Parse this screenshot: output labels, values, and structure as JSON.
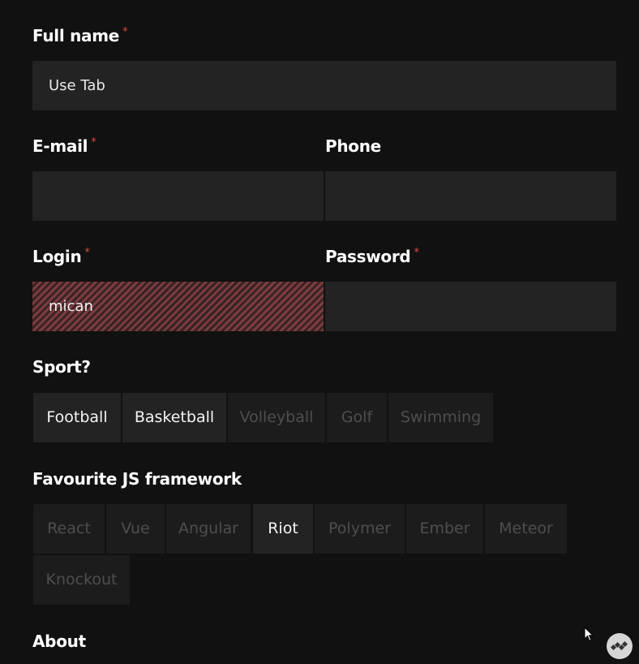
{
  "full_name": {
    "label": "Full name",
    "required_mark": "*",
    "value": "Use Tab"
  },
  "email": {
    "label": "E-mail",
    "required_mark": "*",
    "value": ""
  },
  "phone": {
    "label": "Phone",
    "value": ""
  },
  "login": {
    "label": "Login",
    "required_mark": "*",
    "value": "mican"
  },
  "password": {
    "label": "Password",
    "required_mark": "*",
    "value": ""
  },
  "sport": {
    "label": "Sport?",
    "options": [
      {
        "label": "Football",
        "selected": true
      },
      {
        "label": "Basketball",
        "selected": true
      },
      {
        "label": "Volleyball",
        "selected": false
      },
      {
        "label": "Golf",
        "selected": false
      },
      {
        "label": "Swimming",
        "selected": false
      }
    ]
  },
  "framework": {
    "label": "Favourite JS framework",
    "options": [
      {
        "label": "React",
        "selected": false
      },
      {
        "label": "Vue",
        "selected": false
      },
      {
        "label": "Angular",
        "selected": false
      },
      {
        "label": "Riot",
        "selected": true
      },
      {
        "label": "Polymer",
        "selected": false
      },
      {
        "label": "Ember",
        "selected": false
      },
      {
        "label": "Meteor",
        "selected": false
      },
      {
        "label": "Knockout",
        "selected": false
      }
    ]
  },
  "about": {
    "label": "About"
  },
  "colors": {
    "background": "#111111",
    "field": "#232323",
    "required": "#e0483f",
    "error_stripe": "#7a3c40"
  }
}
